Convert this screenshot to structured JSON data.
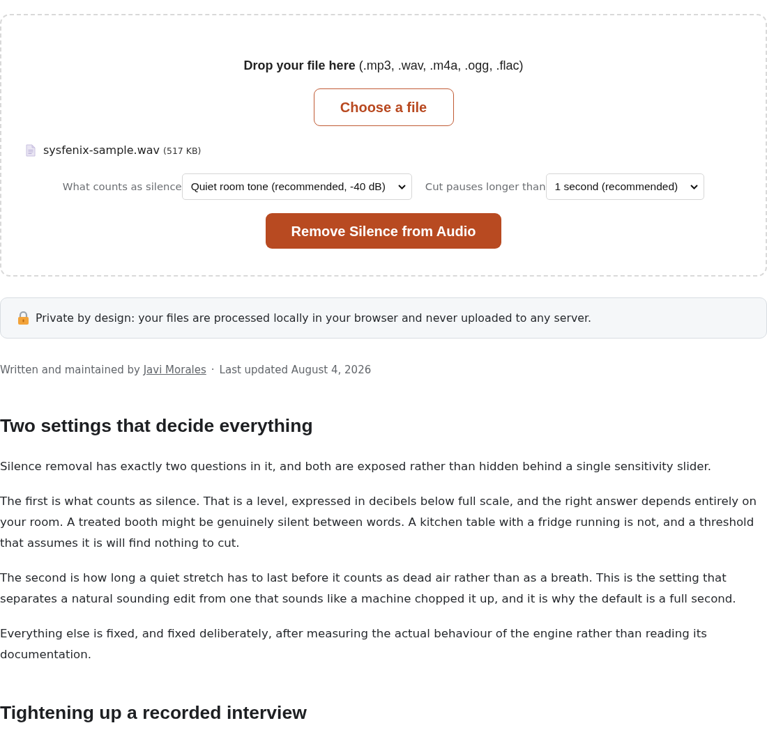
{
  "drop_zone": {
    "prompt": "**Drop your file here** (.mp3, .wav, .m4a, .ogg, .flac)",
    "choose_button": "Choose a file",
    "file": {
      "name": "sysfenix-sample.wav",
      "size": "(517 KB)"
    },
    "settings": [
      {
        "label": "What counts as silence",
        "value": "Quiet room tone (recommended, -40 dB)"
      },
      {
        "label": "Cut pauses longer than",
        "value": "1 second (recommended)"
      }
    ],
    "action_button": "Remove Silence from Audio"
  },
  "privacy_notice": "Private by design: your files are processed locally in your browser and never uploaded to any server.",
  "byline": {
    "prefix": "Written and maintained by",
    "author": "Javi Morales",
    "separator": "·",
    "updated": "Last updated August 4, 2026"
  },
  "article": [
    {
      "kind": "heading",
      "text": "Two settings that decide everything"
    },
    {
      "kind": "paragraph",
      "text": "Silence removal has exactly two questions in it, and both are exposed rather than hidden behind a single sensitivity slider."
    },
    {
      "kind": "paragraph",
      "text": "The first is what counts as silence. That is a level, expressed in decibels below full scale, and the right answer depends entirely on your room. A treated booth might be genuinely silent between words. A kitchen table with a fridge running is not, and a threshold that assumes it is will find nothing to cut."
    },
    {
      "kind": "paragraph",
      "text": "The second is how long a quiet stretch has to last before it counts as dead air rather than as a breath. This is the setting that separates a natural sounding edit from one that sounds like a machine chopped it up, and it is why the default is a full second."
    },
    {
      "kind": "paragraph",
      "text": "Everything else is fixed, and fixed deliberately, after measuring the actual behaviour of the engine rather than reading its documentation."
    },
    {
      "kind": "heading",
      "text": "Tightening up a recorded interview"
    }
  ]
}
